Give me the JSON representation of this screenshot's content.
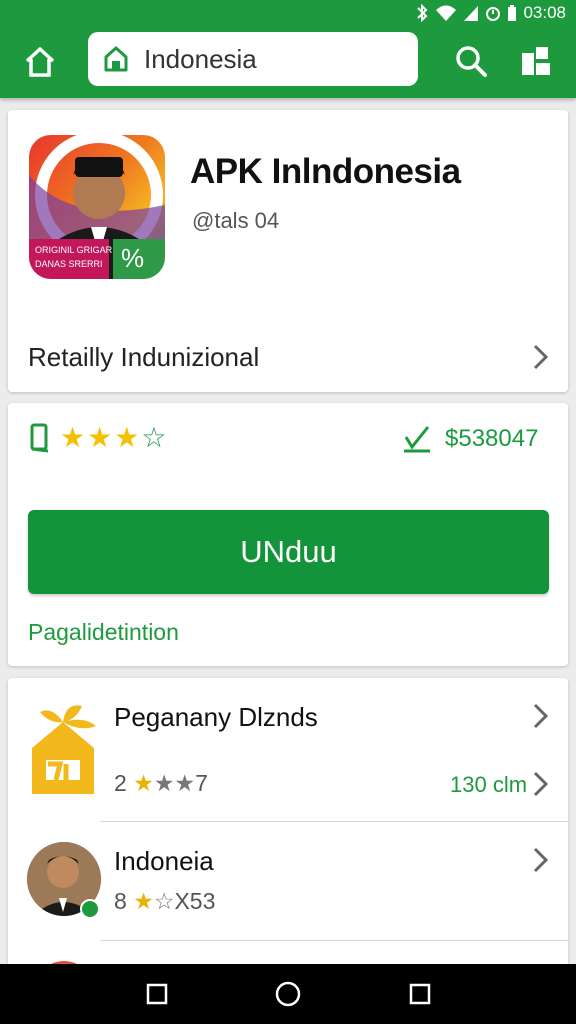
{
  "status_bar": {
    "time": "03:08",
    "icons": [
      "bluetooth-icon",
      "wifi-icon",
      "signal-icon",
      "signal-icon",
      "alarm-icon",
      "battery-icon"
    ]
  },
  "app_bar": {
    "home_icon": "home-icon",
    "search_query": "Indonesia",
    "lock_icon": "lock-icon",
    "search_icon": "search-icon",
    "share_icon": "share-icon",
    "color": "#1e9a3e"
  },
  "app_header": {
    "name": "APK Inlndonesia",
    "handle": "@tals 04",
    "icon_text_1": "ORIGINIL GRIGAR",
    "icon_text_2": "DANAS SRERRI",
    "category": "Retailly Indunizional"
  },
  "stats": {
    "rating_stars": 3.5,
    "price": "$538047"
  },
  "actions": {
    "download_label": "UNduu",
    "details_label": "Pagalidetintion"
  },
  "related": [
    {
      "title": "Peganany Dlznds",
      "rating_prefix": "2",
      "rating_suffix": "7",
      "size": "130 clm"
    },
    {
      "title": "Indoneia",
      "rating_prefix": "8",
      "rating_suffix": "X53"
    }
  ],
  "nav_bar": {
    "buttons": [
      "recents-icon",
      "home-circle-icon",
      "square-icon"
    ]
  }
}
